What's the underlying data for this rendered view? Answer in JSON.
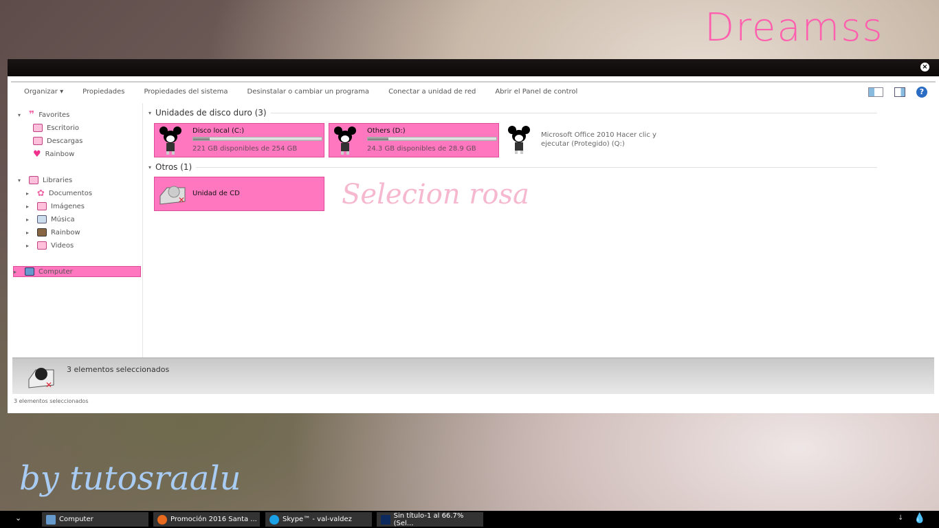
{
  "wallpaper": {
    "title": "Dreamss",
    "signature": "by tutosraalu",
    "caption": "Selecion rosa"
  },
  "window": {
    "close_icon": "close-icon"
  },
  "toolbar": {
    "items": [
      "Organizar",
      "Propiedades",
      "Propiedades del sistema",
      "Desinstalar o cambiar un programa",
      "Conectar a unidad de red",
      "Abrir el Panel de control"
    ],
    "organize_arrow": "▾"
  },
  "nav": {
    "favorites": "Favorites",
    "fav_items": [
      "Escritorio",
      "Descargas",
      "Rainbow"
    ],
    "libraries": "Libraries",
    "lib_items": [
      "Documentos",
      "Imágenes",
      "Música",
      "Rainbow",
      "Videos"
    ],
    "computer": "Computer"
  },
  "content": {
    "hdd_group": "Unidades de disco duro (3)",
    "drives": [
      {
        "name": "Disco local (C:)",
        "free": "221 GB disponibles de 254 GB",
        "used_pct": 13
      },
      {
        "name": "Others (D:)",
        "free": "24.3 GB disponibles de 28.9 GB",
        "used_pct": 16
      }
    ],
    "office": "Microsoft Office 2010 Hacer clic y ejecutar (Protegido) (Q:)",
    "other_group": "Otros (1)",
    "cd": "Unidad de CD"
  },
  "details": {
    "text": "3 elementos seleccionados"
  },
  "status": {
    "text": "3 elementos seleccionados"
  },
  "taskbar": {
    "items": [
      "Computer",
      "Promoción 2016 Santa ...",
      "Skype™ - val-valdez",
      "Sin título-1 al 66.7% (Sel..."
    ]
  },
  "colors": {
    "accent": "#ff78bf",
    "title": "#ff5fae"
  }
}
